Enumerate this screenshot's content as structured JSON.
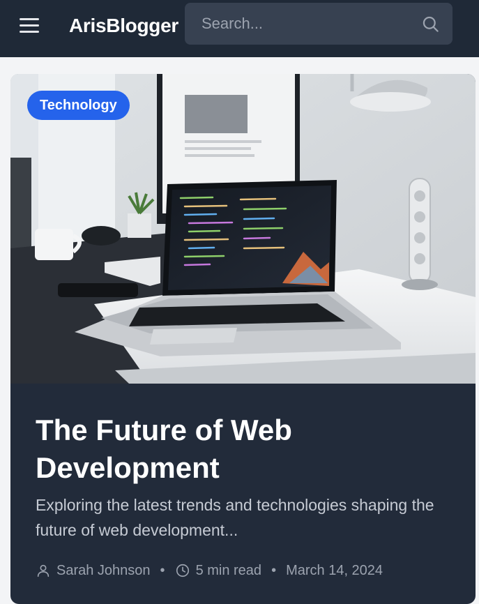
{
  "header": {
    "brand": "ArisBlogger",
    "search": {
      "placeholder": "Search..."
    },
    "icons": {
      "menu": "hamburger-menu-icon",
      "search": "search-icon"
    }
  },
  "post": {
    "category": "Technology",
    "title": "The Future of Web Development",
    "excerpt": "Exploring the latest trends and technologies shaping the future of web development...",
    "author": "Sarah Johnson",
    "read_time": "5 min read",
    "date": "March 14, 2024",
    "separator": "•",
    "icons": {
      "author": "user-icon",
      "read_time": "clock-icon"
    }
  },
  "colors": {
    "topbar": "#1f2937",
    "search_bg": "#374151",
    "card_bg": "#222b3a",
    "badge": "#2563eb",
    "text_primary": "#ffffff",
    "text_muted": "#9ca3af"
  }
}
